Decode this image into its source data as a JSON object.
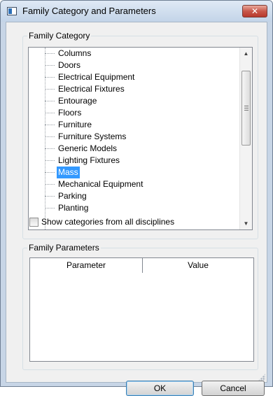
{
  "window": {
    "title": "Family Category and Parameters",
    "close_label": "✕"
  },
  "family_category": {
    "group_label": "Family Category",
    "items": [
      {
        "label": "Columns",
        "selected": false
      },
      {
        "label": "Doors",
        "selected": false
      },
      {
        "label": "Electrical Equipment",
        "selected": false
      },
      {
        "label": "Electrical Fixtures",
        "selected": false
      },
      {
        "label": "Entourage",
        "selected": false
      },
      {
        "label": "Floors",
        "selected": false
      },
      {
        "label": "Furniture",
        "selected": false
      },
      {
        "label": "Furniture Systems",
        "selected": false
      },
      {
        "label": "Generic Models",
        "selected": false
      },
      {
        "label": "Lighting Fixtures",
        "selected": false
      },
      {
        "label": "Mass",
        "selected": true
      },
      {
        "label": "Mechanical Equipment",
        "selected": false
      },
      {
        "label": "Parking",
        "selected": false
      },
      {
        "label": "Planting",
        "selected": false
      }
    ],
    "scroll_arrow_up": "▲",
    "scroll_arrow_down": "▼",
    "show_all_checkbox": {
      "label": "Show categories from all disciplines",
      "checked": false
    }
  },
  "family_parameters": {
    "group_label": "Family Parameters",
    "columns": [
      "Parameter",
      "Value"
    ],
    "rows": []
  },
  "buttons": {
    "ok": "OK",
    "cancel": "Cancel"
  },
  "colors": {
    "selection": "#3399ff",
    "window_frame": "#c7d5e6",
    "close_button": "#c8574a"
  }
}
